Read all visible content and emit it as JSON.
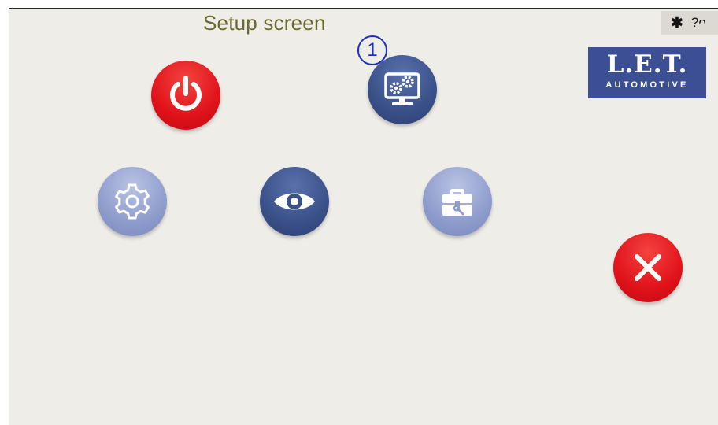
{
  "screen": {
    "title": "Setup screen"
  },
  "status": {
    "bluetooth_glyph": "✱",
    "indicator": "?ᴖ"
  },
  "badge": {
    "number": "1"
  },
  "buttons": [
    {
      "name": "power-button",
      "icon": "power-icon",
      "color": "#e0121a"
    },
    {
      "name": "system-settings-button",
      "icon": "monitor-gears-icon",
      "color": "#3a5088"
    },
    {
      "name": "settings-button",
      "icon": "gear-icon",
      "color": "#8e9ccc"
    },
    {
      "name": "view-button",
      "icon": "eye-icon",
      "color": "#3a5088"
    },
    {
      "name": "tools-button",
      "icon": "toolbox-icon",
      "color": "#8e9ccc"
    },
    {
      "name": "close-button",
      "icon": "close-icon",
      "color": "#e0121a"
    }
  ],
  "logo": {
    "line1": "L.E.T.",
    "line2": "AUTOMOTIVE",
    "color": "#3d4f94"
  }
}
